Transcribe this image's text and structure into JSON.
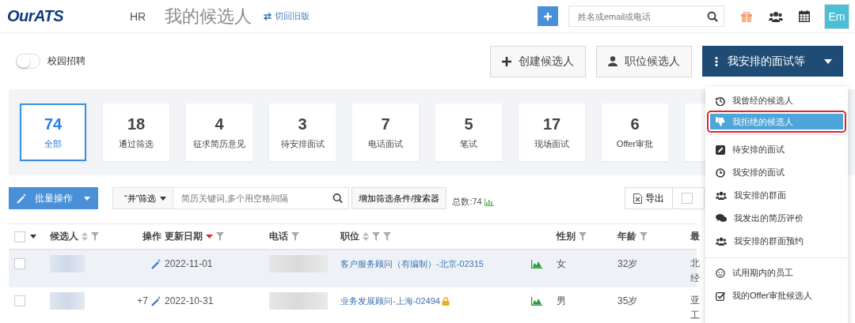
{
  "header": {
    "logo": "OurATS",
    "role": "HR",
    "title": "我的候选人",
    "switch_link": "切回旧版",
    "search": {
      "placeholder": "姓名或email或电话"
    },
    "avatar": "Em"
  },
  "campus_toggle": {
    "label": "校园招聘",
    "on": false
  },
  "actions": [
    {
      "kind": "plus",
      "label": "创建候选人"
    },
    {
      "kind": "user",
      "label": "职位候选人"
    }
  ],
  "menu_button": {
    "label": "我安排的面试等",
    "expanded": true
  },
  "stats": [
    {
      "count": "74",
      "label": "全部",
      "selected": true
    },
    {
      "count": "18",
      "label": "通过筛选",
      "selected": false
    },
    {
      "count": "4",
      "label": "征求简历意见",
      "selected": false
    },
    {
      "count": "3",
      "label": "待安排面试",
      "selected": false
    },
    {
      "count": "7",
      "label": "电话面试",
      "selected": false
    },
    {
      "count": "5",
      "label": "笔试",
      "selected": false
    },
    {
      "count": "17",
      "label": "现场面试",
      "selected": false
    },
    {
      "count": "6",
      "label": "Offer审批",
      "selected": false
    }
  ],
  "toolbar": {
    "bulk": "批量操作",
    "filter_mode": "“并”筛选",
    "keyword": {
      "placeholder": "简历关键词,多个用空格间隔"
    },
    "add_filter": "增加筛选条件/搜索器",
    "total": "总数:74",
    "export": "导出"
  },
  "table": {
    "all_checked": false,
    "columns": [
      {
        "label": "候选人",
        "kind": "sortfilter"
      },
      {
        "label": "操作",
        "kind": "plain"
      },
      {
        "label": "更新日期",
        "kind": "sorted"
      },
      {
        "label": "电话",
        "kind": "filter"
      },
      {
        "label": "职位",
        "kind": "sortfilter2"
      },
      {
        "label": "性别",
        "kind": "filter"
      },
      {
        "label": "年龄",
        "kind": "filter"
      },
      {
        "label": "最",
        "kind": "plain"
      }
    ],
    "rows": [
      {
        "checked": false,
        "highlighted": true,
        "date": "2022-11-01",
        "position": "客户服务顾问（有编制）-北京-02315",
        "locked": false,
        "gender": "女",
        "age": "32岁",
        "column_8": [
          "北",
          "经"
        ]
      },
      {
        "checked": false,
        "highlighted": false,
        "ops_count": "+7",
        "date": "2022-10-31",
        "position": "业务发展顾问-上海-02494",
        "locked": true,
        "gender": "男",
        "age": "35岁",
        "column_8": [
          "亚",
          "工"
        ]
      }
    ]
  },
  "menu_groups": [
    {
      "items": [
        {
          "kind": "history",
          "label": "我曾经的候选人",
          "selected": false
        },
        {
          "kind": "dislike",
          "label": "我拒绝的候选人",
          "selected": true
        }
      ]
    },
    {
      "items": [
        {
          "kind": "edit",
          "label": "待安排的面试",
          "selected": false
        },
        {
          "kind": "clock",
          "label": "我安排的面试",
          "selected": false
        },
        {
          "kind": "group",
          "label": "我安排的群面",
          "selected": false
        },
        {
          "kind": "comments",
          "label": "我发出的简历评价",
          "selected": false
        },
        {
          "kind": "group",
          "label": "我安排的群面预约",
          "selected": false
        }
      ]
    },
    {
      "items": [
        {
          "kind": "smile",
          "label": "试用期内的员工",
          "selected": false
        },
        {
          "kind": "checkbox",
          "label": "我的Offer审批候选人",
          "selected": false
        }
      ]
    }
  ]
}
